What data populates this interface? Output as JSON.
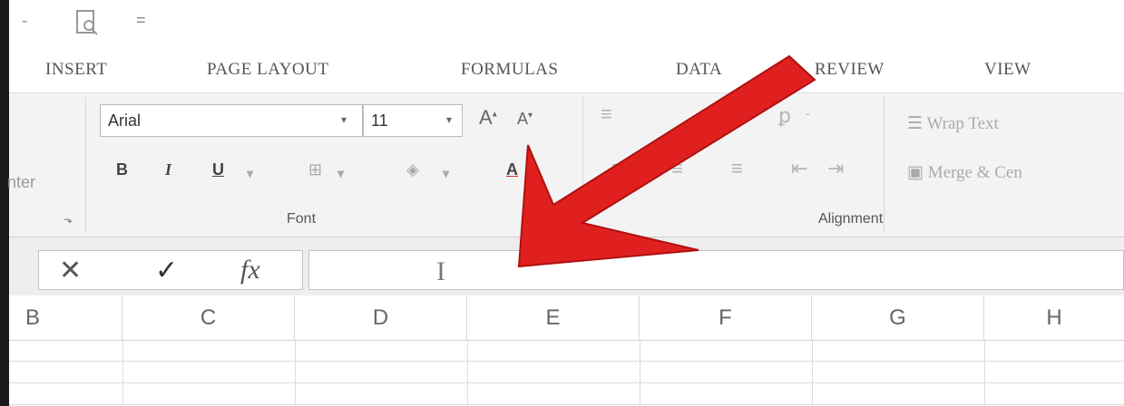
{
  "quick_access": {
    "separator": "-",
    "more": "="
  },
  "tabs": [
    {
      "label": "INSERT"
    },
    {
      "label": "PAGE LAYOUT"
    },
    {
      "label": "FORMULAS"
    },
    {
      "label": "DATA"
    },
    {
      "label": "REVIEW"
    },
    {
      "label": "VIEW"
    }
  ],
  "clipboard": {
    "partial_label": "nter"
  },
  "font_group": {
    "font_name": "Arial",
    "font_size": "11",
    "grow_label": "A",
    "shrink_label": "A",
    "bold_label": "B",
    "italic_label": "I",
    "underline_label": "U",
    "font_color_label": "A",
    "group_label": "Font"
  },
  "alignment_group": {
    "wrap_text": "Wrap Text",
    "merge_center": "Merge & Cen",
    "group_label": "Alignment"
  },
  "formula_bar": {
    "cancel_glyph": "✕",
    "enter_glyph": "✓",
    "fx_label": "fx",
    "value": ""
  },
  "columns": [
    "B",
    "C",
    "D",
    "E",
    "F",
    "G",
    "H"
  ],
  "colors": {
    "arrow": "#e0201f",
    "ribbon_bg": "#f3f3f3"
  }
}
